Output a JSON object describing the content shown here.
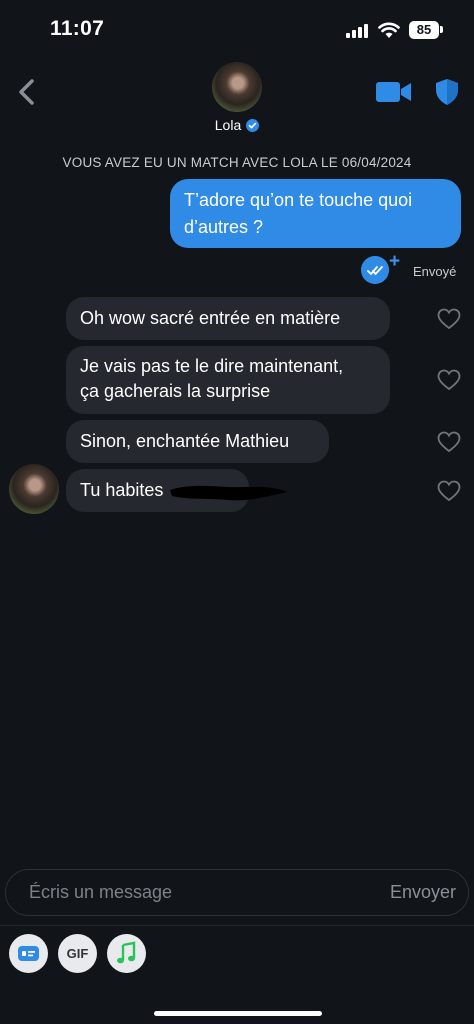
{
  "status": {
    "time": "11:07",
    "battery": "85"
  },
  "header": {
    "name": "Lola"
  },
  "match_banner": "VOUS AVEZ EU UN MATCH AVEC LOLA LE 06/04/2024",
  "messages": {
    "sent": [
      {
        "text_line1": "T’adore qu’on te touche quoi",
        "text_line2": "d’autres ?",
        "status": "Envoyé"
      }
    ],
    "received": [
      {
        "text": "Oh wow sacré entrée en matière"
      },
      {
        "text_line1": "Je vais pas te le dire maintenant,",
        "text_line2": "ça gacherais la surprise"
      },
      {
        "text": "Sinon, enchantée Mathieu"
      },
      {
        "text": "Tu habites"
      }
    ]
  },
  "composer": {
    "placeholder": "Écris un message",
    "send_label": "Envoyer"
  },
  "toolbar": {
    "gif_label": "GIF"
  },
  "colors": {
    "accent": "#2f8be6",
    "bubble_received": "#25282e",
    "background": "#111418"
  }
}
